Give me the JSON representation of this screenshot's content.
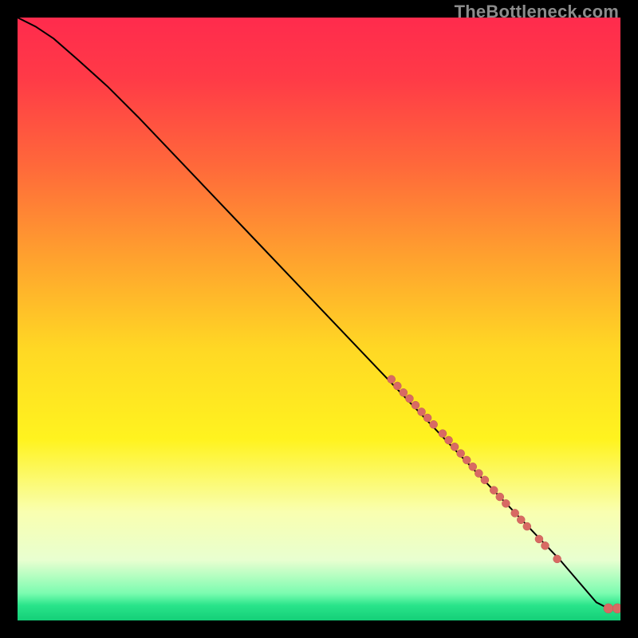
{
  "watermark": {
    "text": "TheBottleneck.com"
  },
  "colors": {
    "black": "#000000",
    "gradient_stops": [
      {
        "offset": 0.0,
        "color": "#ff2b4d"
      },
      {
        "offset": 0.1,
        "color": "#ff3a47"
      },
      {
        "offset": 0.25,
        "color": "#ff6a3a"
      },
      {
        "offset": 0.4,
        "color": "#ffa22e"
      },
      {
        "offset": 0.55,
        "color": "#ffd824"
      },
      {
        "offset": 0.7,
        "color": "#fff31f"
      },
      {
        "offset": 0.82,
        "color": "#f9ffb0"
      },
      {
        "offset": 0.9,
        "color": "#e8ffd0"
      },
      {
        "offset": 0.955,
        "color": "#7bfcb0"
      },
      {
        "offset": 0.975,
        "color": "#29e48a"
      },
      {
        "offset": 1.0,
        "color": "#14cf78"
      }
    ],
    "curve": "#000000",
    "dot_fill": "#d86a63",
    "dot_stroke": "#c15a54"
  },
  "chart_data": {
    "type": "line",
    "title": "",
    "xlabel": "",
    "ylabel": "",
    "xlim": [
      0,
      100
    ],
    "ylim": [
      0,
      100
    ],
    "grid": false,
    "series": [
      {
        "name": "curve",
        "x": [
          0,
          3,
          6,
          10,
          15,
          20,
          30,
          40,
          50,
          60,
          70,
          80,
          90,
          93,
          96,
          98,
          100
        ],
        "y": [
          100,
          98.5,
          96.5,
          93,
          88.5,
          83.5,
          73,
          62.5,
          52,
          41.5,
          31,
          20.5,
          10,
          6.5,
          3,
          2,
          2
        ]
      }
    ],
    "scatter_points": [
      {
        "x": 62,
        "y": 40.0,
        "r": 5
      },
      {
        "x": 63,
        "y": 38.9,
        "r": 5
      },
      {
        "x": 64,
        "y": 37.8,
        "r": 5
      },
      {
        "x": 65,
        "y": 36.8,
        "r": 5
      },
      {
        "x": 66,
        "y": 35.7,
        "r": 5
      },
      {
        "x": 67,
        "y": 34.6,
        "r": 5
      },
      {
        "x": 68,
        "y": 33.6,
        "r": 5
      },
      {
        "x": 69,
        "y": 32.5,
        "r": 5
      },
      {
        "x": 70.5,
        "y": 31.0,
        "r": 5
      },
      {
        "x": 71.5,
        "y": 29.9,
        "r": 5
      },
      {
        "x": 72.5,
        "y": 28.8,
        "r": 5
      },
      {
        "x": 73.5,
        "y": 27.7,
        "r": 5
      },
      {
        "x": 74.5,
        "y": 26.6,
        "r": 5
      },
      {
        "x": 75.5,
        "y": 25.5,
        "r": 5
      },
      {
        "x": 76.5,
        "y": 24.4,
        "r": 5
      },
      {
        "x": 77.5,
        "y": 23.3,
        "r": 5
      },
      {
        "x": 79.0,
        "y": 21.6,
        "r": 5
      },
      {
        "x": 80.0,
        "y": 20.5,
        "r": 5
      },
      {
        "x": 81.0,
        "y": 19.4,
        "r": 5
      },
      {
        "x": 82.5,
        "y": 17.8,
        "r": 5
      },
      {
        "x": 83.5,
        "y": 16.7,
        "r": 5
      },
      {
        "x": 84.5,
        "y": 15.6,
        "r": 5
      },
      {
        "x": 86.5,
        "y": 13.5,
        "r": 5
      },
      {
        "x": 87.5,
        "y": 12.4,
        "r": 5
      },
      {
        "x": 89.5,
        "y": 10.2,
        "r": 5
      },
      {
        "x": 98.0,
        "y": 2.0,
        "r": 6
      },
      {
        "x": 99.5,
        "y": 2.0,
        "r": 6
      }
    ]
  }
}
